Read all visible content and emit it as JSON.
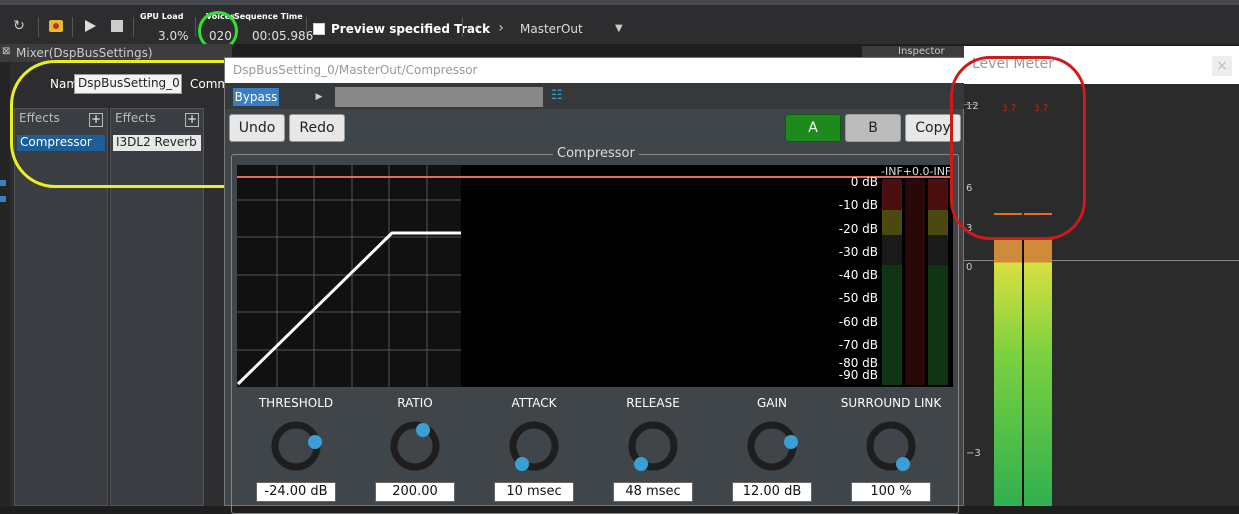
{
  "toolbar": {
    "gpu_load_label": "GPU Load",
    "gpu_load_value": "3.0%",
    "voices_label": "Voices",
    "voices_value": "020",
    "sequence_time_label": "Sequence Time",
    "sequence_time_value": "00:05.986",
    "preview_label": "Preview specified Track",
    "track_select": "MasterOut"
  },
  "mixer": {
    "tab_title": "Mixer(DspBusSettings)",
    "name_label": "Name",
    "name_value": "DspBusSetting_0",
    "comment_label": "Comm",
    "effects_header_1": "Effects",
    "effects_header_2": "Effects",
    "effect_1_item": "Compressor",
    "effect_2_item": "I3DL2 Reverb"
  },
  "compressor": {
    "window_title": "DspBusSetting_0/MasterOut/Compressor",
    "bypass_label": "Bypass",
    "undo_label": "Undo",
    "redo_label": "Redo",
    "a_label": "A",
    "b_label": "B",
    "copy_label": "Copy",
    "group_title": "Compressor",
    "db_ticks": [
      "0 dB",
      "-10 dB",
      "-20 dB",
      "-30 dB",
      "-40 dB",
      "-50 dB",
      "-60 dB",
      "-70 dB",
      "-80 dB",
      "-90 dB"
    ],
    "meter_readout": "-INF+0.0-INF",
    "knobs": [
      {
        "label": "THRESHOLD",
        "value": "-24.00 dB"
      },
      {
        "label": "RATIO",
        "value": "200.00"
      },
      {
        "label": "ATTACK",
        "value": "10 msec"
      },
      {
        "label": "RELEASE",
        "value": "48 msec"
      },
      {
        "label": "GAIN",
        "value": "12.00 dB"
      },
      {
        "label": "SURROUND LINK",
        "value": "100 %"
      }
    ],
    "accent_color": "#1e8a1e",
    "knob_color": "#3a9fd6"
  },
  "level_meter": {
    "title": "Level Meter",
    "scale_12": "12",
    "scale_6": "6",
    "scale_3": "3",
    "scale_0": "0",
    "scale_m3": "−3",
    "peak_left": "3.7",
    "peak_right": "3.7"
  },
  "inspector_label": "Inspector"
}
